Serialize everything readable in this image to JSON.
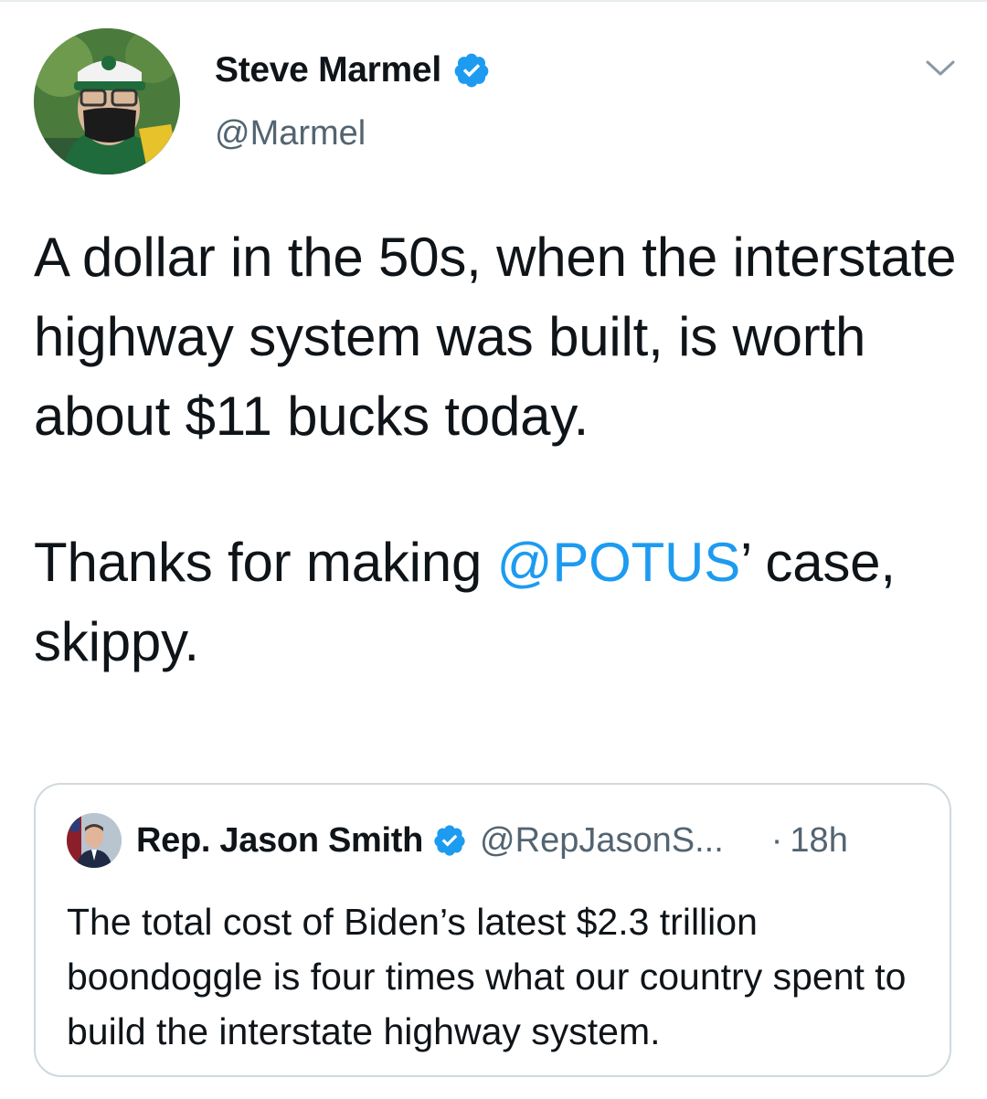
{
  "tweet": {
    "author": {
      "name": "Steve Marmel",
      "handle": "@Marmel",
      "verified": true,
      "avatar_icon": "profile-photo"
    },
    "menu_icon": "chevron-down-icon",
    "text": {
      "line_part1": "A dollar in the 50s, when the interstate highway system was built, is worth about $11 bucks today.",
      "line_part2_prefix": "Thanks for making ",
      "mention": "@POTUS",
      "line_part2_suffix": "’ case, skippy."
    }
  },
  "quoted_tweet": {
    "author": {
      "name": "Rep. Jason Smith",
      "handle": "@RepJasonS...",
      "verified": true,
      "avatar_icon": "profile-photo"
    },
    "separator": "·",
    "time": "18h",
    "text": "The total cost of Biden’s latest $2.3 trillion boondoggle is four times what our country spent to build the interstate highway system."
  },
  "colors": {
    "accent": "#1d9bf0",
    "text": "#0f1419",
    "secondary": "#536471",
    "border": "#cfd9de"
  }
}
